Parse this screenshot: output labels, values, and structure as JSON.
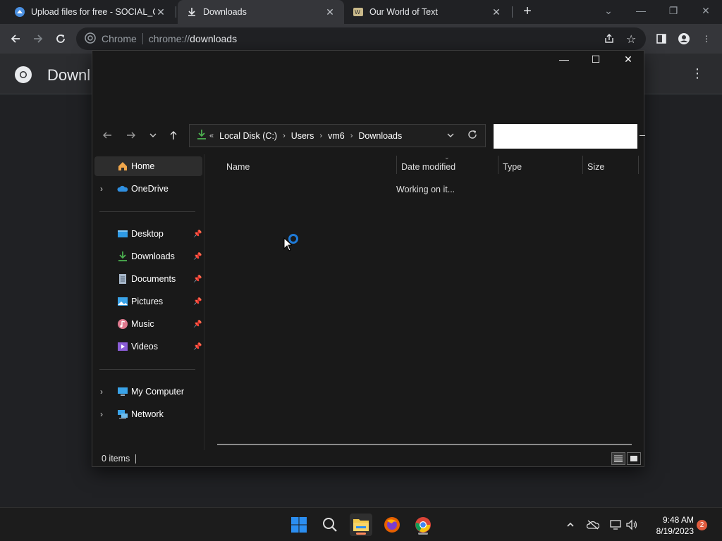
{
  "browser": {
    "tabs": [
      {
        "title": "Upload files for free - SOCIAL_CR",
        "active": false
      },
      {
        "title": "Downloads",
        "active": true
      },
      {
        "title": "Our World of Text",
        "active": false
      }
    ],
    "omnibox": {
      "chip": "Chrome",
      "url_scheme": "chrome://",
      "url_host": "downloads"
    }
  },
  "downloads_page": {
    "title": "Downl"
  },
  "explorer": {
    "breadcrumb": [
      "Local Disk (C:)",
      "Users",
      "vm6",
      "Downloads"
    ],
    "breadcrumb_overflow": "«",
    "search_value": "",
    "sidebar": {
      "group1": [
        {
          "label": "Home",
          "selected": true
        },
        {
          "label": "OneDrive",
          "expandable": true
        }
      ],
      "quick_access": [
        {
          "label": "Desktop",
          "pinned": true
        },
        {
          "label": "Downloads",
          "pinned": true
        },
        {
          "label": "Documents",
          "pinned": true
        },
        {
          "label": "Pictures",
          "pinned": true
        },
        {
          "label": "Music",
          "pinned": true
        },
        {
          "label": "Videos",
          "pinned": true
        }
      ],
      "group3": [
        {
          "label": "My Computer",
          "expandable": true
        },
        {
          "label": "Network",
          "expandable": true
        }
      ]
    },
    "columns": [
      "Name",
      "Date modified",
      "Type",
      "Size"
    ],
    "status_message": "Working on it...",
    "item_count": "0 items"
  },
  "taskbar": {
    "clock_time": "9:48 AM",
    "clock_date": "8/19/2023",
    "notification_count": "2"
  },
  "colors": {
    "accent_blue": "#1f7ad6",
    "download_green": "#4caf50"
  }
}
